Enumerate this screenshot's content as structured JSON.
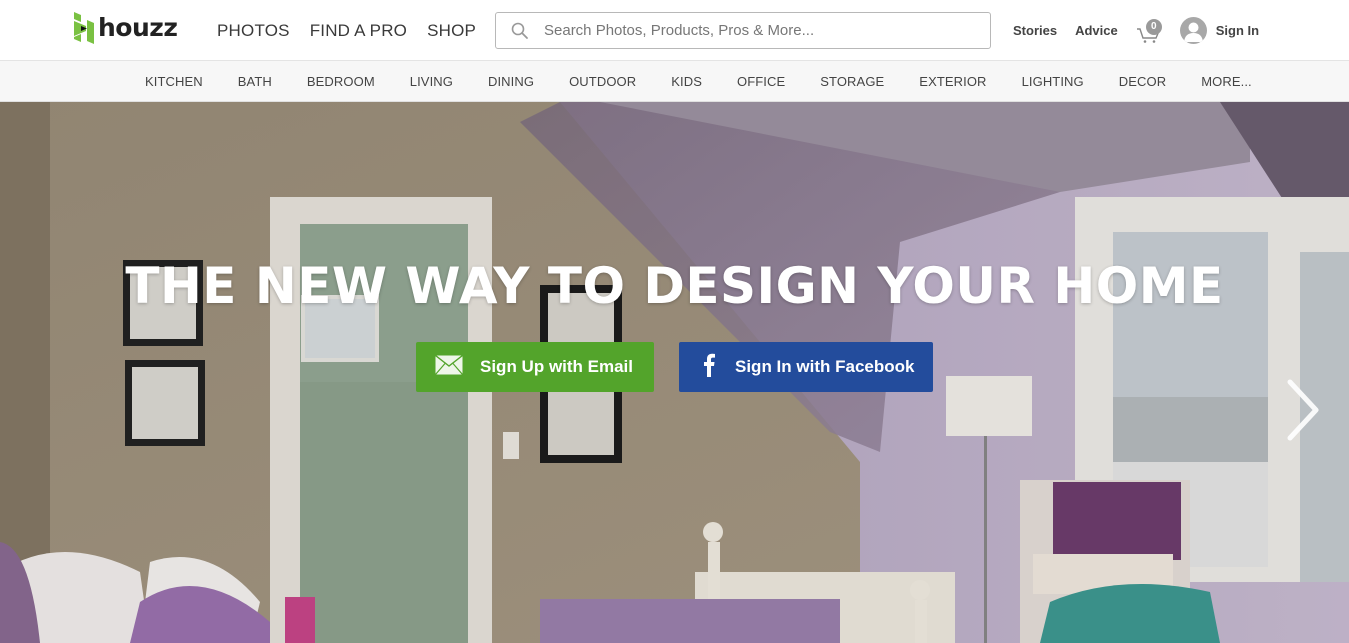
{
  "brand": {
    "name": "houzz",
    "logo_color": "#7ac142"
  },
  "header": {
    "main_nav": [
      {
        "label": "PHOTOS"
      },
      {
        "label": "FIND A PRO"
      },
      {
        "label": "SHOP"
      }
    ],
    "search": {
      "placeholder": "Search Photos, Products, Pros & More...",
      "value": ""
    },
    "right_nav": {
      "stories": "Stories",
      "advice": "Advice",
      "cart_count": "0",
      "sign_in": "Sign In"
    }
  },
  "categories": [
    {
      "label": "KITCHEN"
    },
    {
      "label": "BATH"
    },
    {
      "label": "BEDROOM"
    },
    {
      "label": "LIVING"
    },
    {
      "label": "DINING"
    },
    {
      "label": "OUTDOOR"
    },
    {
      "label": "KIDS"
    },
    {
      "label": "OFFICE"
    },
    {
      "label": "STORAGE"
    },
    {
      "label": "EXTERIOR"
    },
    {
      "label": "LIGHTING"
    },
    {
      "label": "DECOR"
    },
    {
      "label": "MORE..."
    }
  ],
  "hero": {
    "headline": "THE NEW WAY TO DESIGN YOUR HOME",
    "email_button": "Sign Up with Email",
    "facebook_button": "Sign In with Facebook",
    "email_color": "#53a42b",
    "facebook_color": "#234c9c",
    "next_icon": "chevron-right-icon"
  }
}
